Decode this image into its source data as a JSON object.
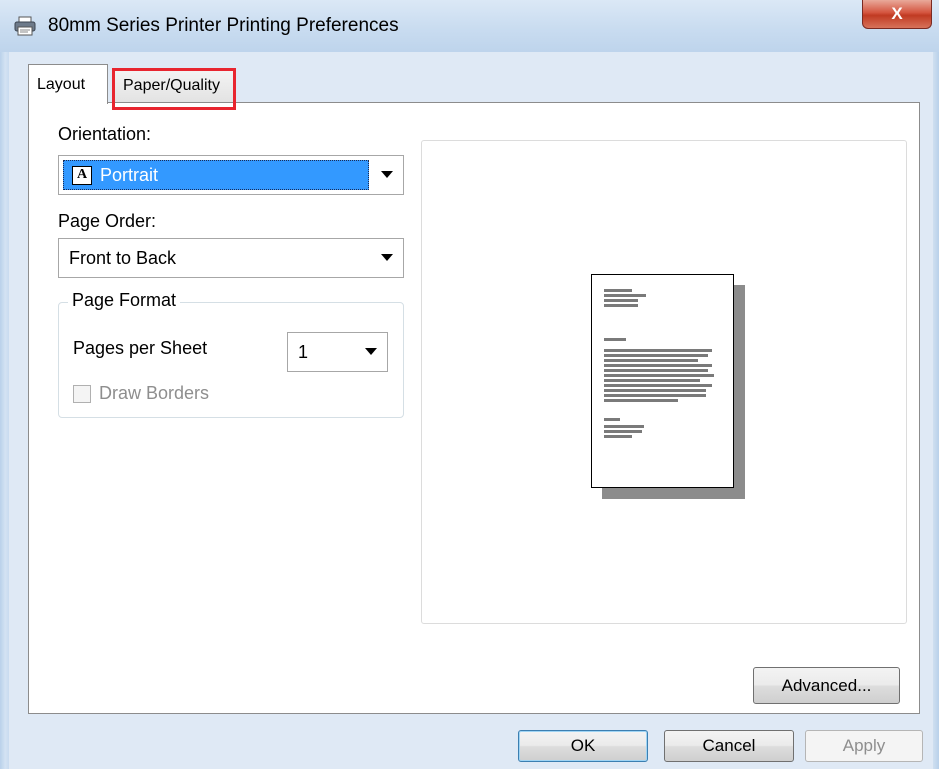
{
  "window": {
    "title": "80mm Series Printer Printing Preferences",
    "close_label": "X"
  },
  "tabs": [
    {
      "label": "Layout",
      "active": true
    },
    {
      "label": "Paper/Quality",
      "active": false,
      "highlighted": true
    }
  ],
  "layout": {
    "orientation_label": "Orientation:",
    "orientation_value": "Portrait",
    "orientation_glyph": "A",
    "page_order_label": "Page Order:",
    "page_order_value": "Front to Back",
    "page_format": {
      "title": "Page Format",
      "pages_per_sheet_label": "Pages per Sheet",
      "pages_per_sheet_value": "1",
      "draw_borders_label": "Draw Borders",
      "draw_borders_checked": false,
      "draw_borders_enabled": false
    },
    "advanced_label": "Advanced..."
  },
  "footer": {
    "ok_label": "OK",
    "cancel_label": "Cancel",
    "apply_label": "Apply",
    "apply_enabled": false
  },
  "colors": {
    "highlight": "#e8252f",
    "selection": "#3399ff",
    "close_button": "#c03a22"
  }
}
